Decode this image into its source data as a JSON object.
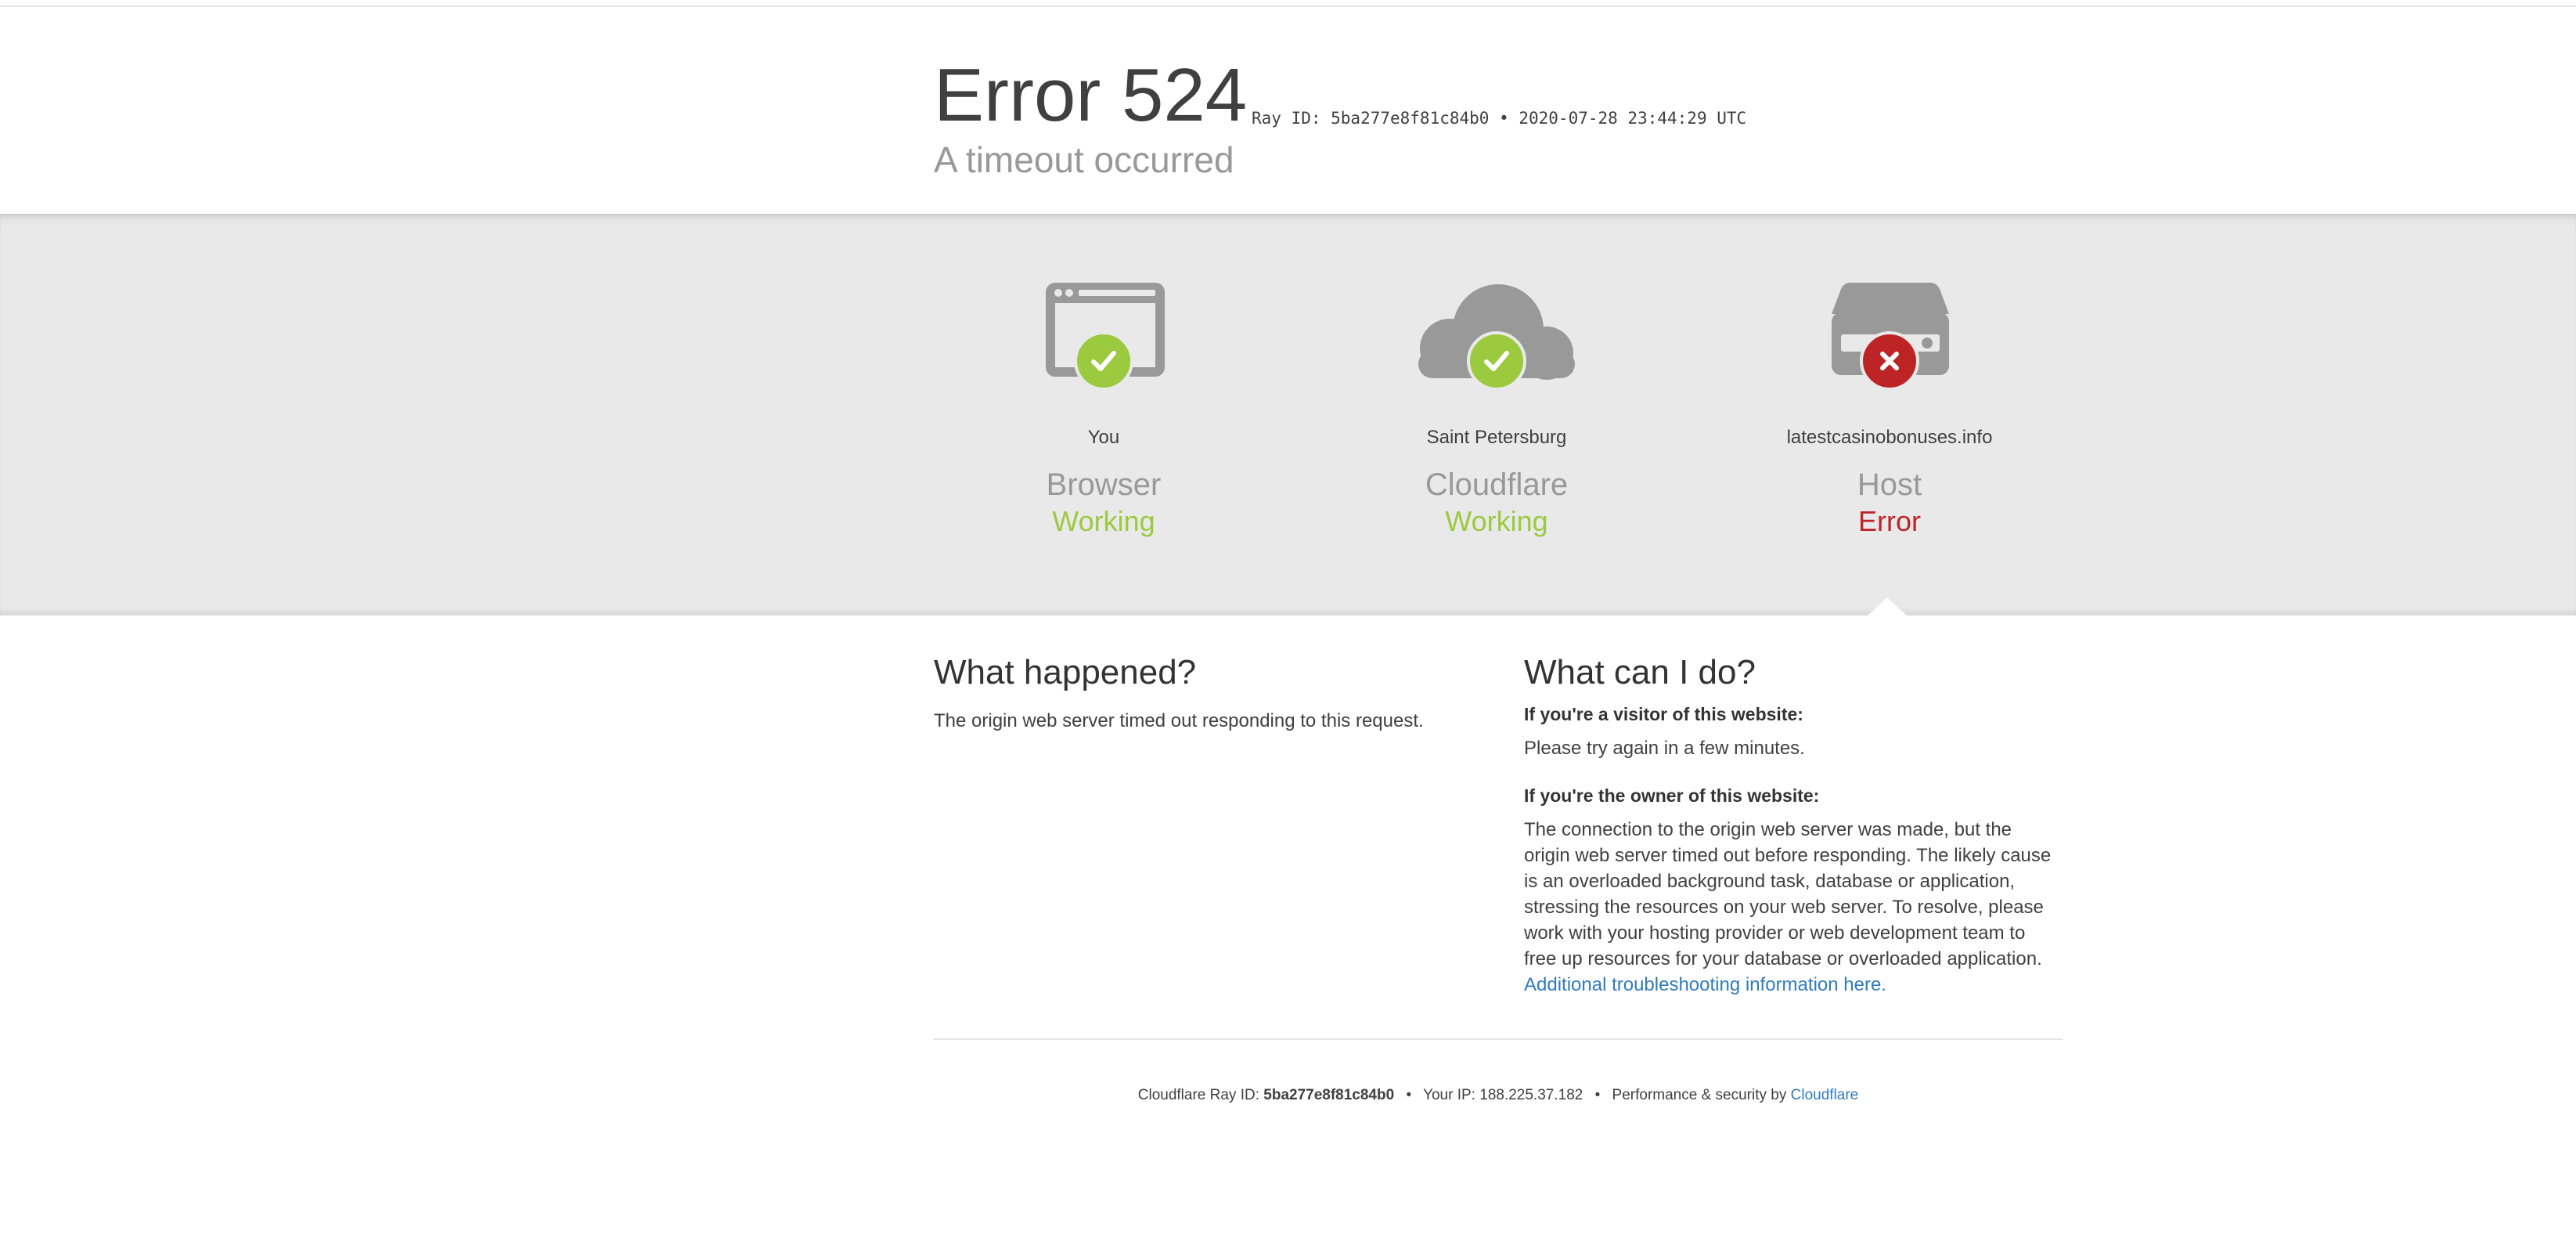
{
  "header": {
    "title": "Error 524",
    "ray_line": "Ray ID: 5ba277e8f81c84b0 • 2020-07-28 23:44:29 UTC",
    "subtitle": "A timeout occurred"
  },
  "status": [
    {
      "location": "You",
      "label": "Browser",
      "status": "Working",
      "icon": "browser-icon",
      "badge": "check-icon"
    },
    {
      "location": "Saint Petersburg",
      "label": "Cloudflare",
      "status": "Working",
      "icon": "cloud-icon",
      "badge": "check-icon"
    },
    {
      "location": "latestcasinobonuses.info",
      "label": "Host",
      "status": "Error",
      "icon": "server-icon",
      "badge": "x-icon"
    }
  ],
  "colors": {
    "ok": "#9bca3e",
    "error": "#bd2426",
    "icon_gray": "#999999",
    "link": "#2f7bbf"
  },
  "what_happened": {
    "heading": "What happened?",
    "text": "The origin web server timed out responding to this request."
  },
  "what_can_i_do": {
    "heading": "What can I do?",
    "visitor_heading": "If you're a visitor of this website:",
    "visitor_text": "Please try again in a few minutes.",
    "owner_heading": "If you're the owner of this website:",
    "owner_text": "The connection to the origin web server was made, but the origin web server timed out before responding. The likely cause is an overloaded background task, database or application, stressing the resources on your web server. To resolve, please work with your hosting provider or web development team to free up resources for your database or overloaded application.",
    "link_text": "Additional troubleshooting information here."
  },
  "footer": {
    "ray_label": "Cloudflare Ray ID:",
    "ray_id": "5ba277e8f81c84b0",
    "ip_label": "Your IP:",
    "ip": "188.225.37.182",
    "perf_text": "Performance & security by",
    "brand": "Cloudflare"
  }
}
